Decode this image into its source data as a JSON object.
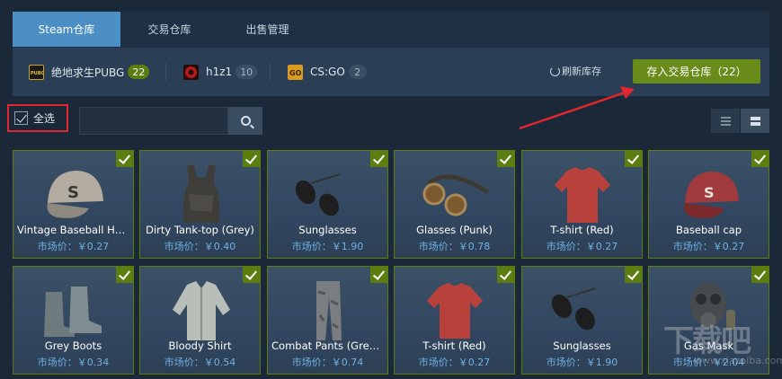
{
  "tabs": [
    {
      "label": "Steam仓库",
      "active": true
    },
    {
      "label": "交易仓库",
      "active": false
    },
    {
      "label": "出售管理",
      "active": false
    }
  ],
  "games": [
    {
      "name": "绝地求生PUBG",
      "count": "22",
      "icon": "pubg-icon",
      "badge_color": "#5c7e10"
    },
    {
      "name": "h1z1",
      "count": "10",
      "icon": "h1z1-icon",
      "badge_color": "#3a4f63"
    },
    {
      "name": "CS:GO",
      "count": "2",
      "icon": "csgo-icon",
      "badge_color": "#3a4f63"
    }
  ],
  "refresh_label": "刷新库存",
  "deposit_label": "存入交易仓库（22）",
  "select_all_label": "全选",
  "search": {
    "value": "",
    "placeholder": ""
  },
  "colors": {
    "accent_tab": "#4b8fc4",
    "deposit_button": "#688b19",
    "selected_border": "#5c7e10",
    "price_text": "#6fb2e6",
    "highlight": "#e0262e"
  },
  "items": [
    {
      "name": "Vintage Baseball Ha…",
      "price": "市场价：￥0.27",
      "icon": "baseball-cap-icon"
    },
    {
      "name": "Dirty Tank-top (Grey)",
      "price": "市场价：￥0.40",
      "icon": "tank-top-icon"
    },
    {
      "name": "Sunglasses",
      "price": "市场价：￥1.90",
      "icon": "sunglasses-icon"
    },
    {
      "name": "Glasses (Punk)",
      "price": "市场价：￥0.78",
      "icon": "goggles-icon"
    },
    {
      "name": "T-shirt (Red)",
      "price": "市场价：￥0.27",
      "icon": "tshirt-icon"
    },
    {
      "name": "Baseball cap",
      "price": "市场价：￥0.27",
      "icon": "baseball-cap-icon"
    },
    {
      "name": "Grey Boots",
      "price": "市场价：￥0.34",
      "icon": "boots-icon"
    },
    {
      "name": "Bloody Shirt",
      "price": "市场价：￥0.54",
      "icon": "shirt-icon"
    },
    {
      "name": "Combat Pants (Grey…",
      "price": "市场价：￥0.74",
      "icon": "pants-icon"
    },
    {
      "name": "T-shirt (Red)",
      "price": "市场价：￥0.27",
      "icon": "tshirt-icon"
    },
    {
      "name": "Sunglasses",
      "price": "市场价：￥1.90",
      "icon": "sunglasses-icon"
    },
    {
      "name": "Gas Mask",
      "price": "市场价：￥2.04",
      "icon": "gas-mask-icon"
    }
  ],
  "watermark": "下载吧",
  "watermark_url": "www.xiazaiba.com"
}
